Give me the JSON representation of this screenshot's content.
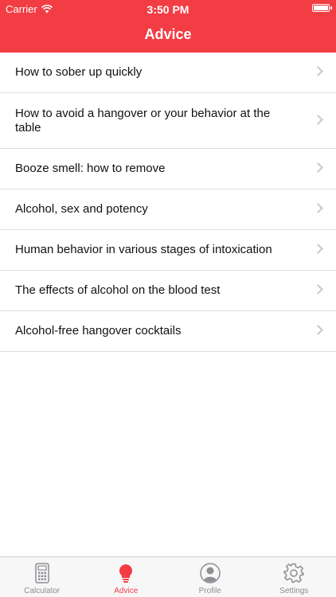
{
  "status_bar": {
    "carrier": "Carrier",
    "time": "3:50 PM"
  },
  "nav": {
    "title": "Advice"
  },
  "advice_items": [
    {
      "label": "How to sober up quickly"
    },
    {
      "label": "How to avoid a hangover or your behavior at the table"
    },
    {
      "label": "Booze smell: how to remove"
    },
    {
      "label": "Alcohol, sex and potency"
    },
    {
      "label": "Human behavior in various stages of intoxication"
    },
    {
      "label": "The effects of alcohol on the blood test"
    },
    {
      "label": "Alcohol-free hangover cocktails"
    }
  ],
  "tabs": [
    {
      "label": "Calculator",
      "icon": "calculator-icon",
      "active": false
    },
    {
      "label": "Advice",
      "icon": "lightbulb-icon",
      "active": true
    },
    {
      "label": "Profile",
      "icon": "profile-icon",
      "active": false
    },
    {
      "label": "Settings",
      "icon": "gear-icon",
      "active": false
    }
  ],
  "colors": {
    "accent": "#f23d44",
    "inactive_tab": "#8e8e93",
    "separator": "#dedee2"
  }
}
